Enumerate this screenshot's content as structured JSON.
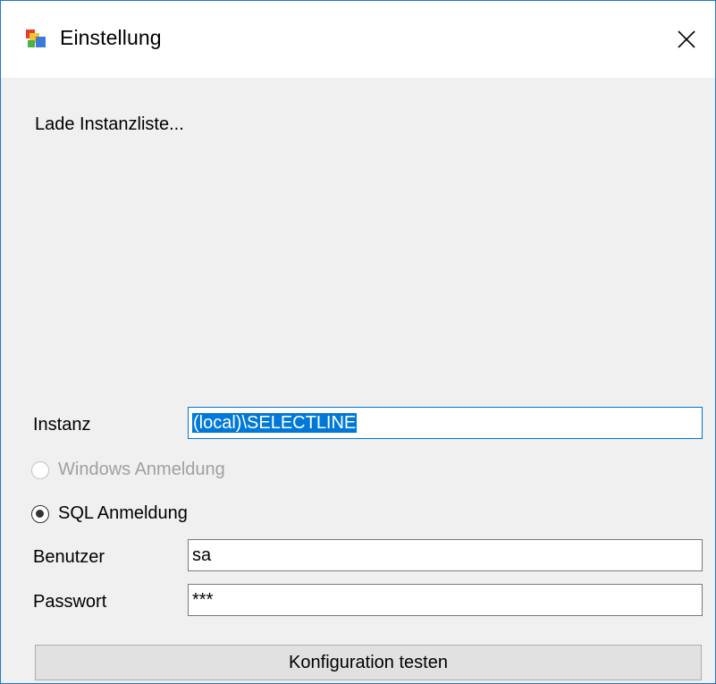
{
  "window": {
    "title": "Einstellung",
    "icon": "app-settings-icon",
    "close_icon": "close-icon"
  },
  "status_text": "Lade Instanzliste...",
  "form": {
    "instance_label": "Instanz",
    "instance_value": "(local)\\SELECTLINE",
    "windows_auth_label": "Windows Anmeldung",
    "sql_auth_label": "SQL Anmeldung",
    "selected_auth": "SQL Anmeldung",
    "user_label": "Benutzer",
    "user_value": "sa",
    "password_label": "Passwort",
    "password_value": "***",
    "test_button_label": "Konfiguration testen"
  },
  "colors": {
    "accent": "#0078d7",
    "window_border": "#1e78d8",
    "background": "#f0f0f0"
  }
}
